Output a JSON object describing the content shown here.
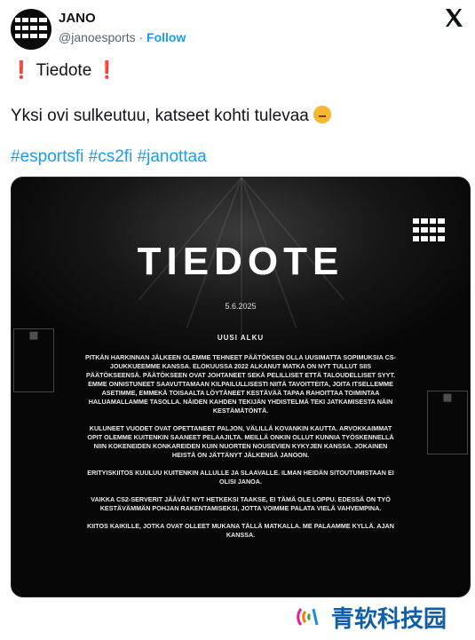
{
  "author": {
    "name": "JANO",
    "handle": "@janoesports",
    "follow_label": "Follow",
    "avatar_text": "JANO"
  },
  "x_icon": "x-logo-icon",
  "tweet": {
    "line1": "Tiedote",
    "line2": "Yksi ovi sulkeutuu, katseet kohti tulevaa",
    "hashtags": "#esportsfi #cs2fi #janottaa"
  },
  "media": {
    "title": "TIEDOTE",
    "date": "5.6.2025",
    "subheading": "UUSI ALKU",
    "paragraphs": [
      "Pitkän harkinnan jälkeen olemme tehneet päätöksen olla uusimatta sopimuksia CS-joukkueemme kanssa. Elokuussa 2022 alkanut matka on nyt tullut siis päätökseensä. Päätökseen ovat johtaneet sekä pelilliset että taloudelliset syyt. Emme onnistuneet saavuttamaan kilpailullisesti niitä tavoitteita, joita itsellemme asetimme, emmekä toisaalta löytäneet kestävää tapaa rahoittaa toimintaa haluamallamme tasolla. Näiden kahden tekijän yhdistelmä teki jatkamisesta näin kestämätöntä.",
      "Kuluneet vuodet ovat opettaneet paljon, välillä kovankin kautta. Arvokkaimmat opit olemme kuitenkin saaneet pelaajilta. Meillä onkin ollut kunnia työskennellä niin kokeneiden konkareiden kuin nuorten nousevien kykyjen kanssa. Jokainen heistä on jättänyt jälkensä Janoon.",
      "Erityiskiitos kuuluu kuitenkin allulle ja slaavalle. Ilman heidän sitoutumistaan ei olisi Janoa.",
      "Vaikka CS2-serverit jäävät nyt hetkeksi taakse, ei tämä ole loppu. Edessä on työ kestävämmän pohjan rakentamiseksi, jotta voimme palata vielä vahvempina.",
      "Kiitos kaikille, jotka ovat olleet mukana tällä matkalla. Me palaamme kyllä. Ajan kanssa."
    ]
  },
  "watermark": {
    "text": "青软科技园"
  }
}
